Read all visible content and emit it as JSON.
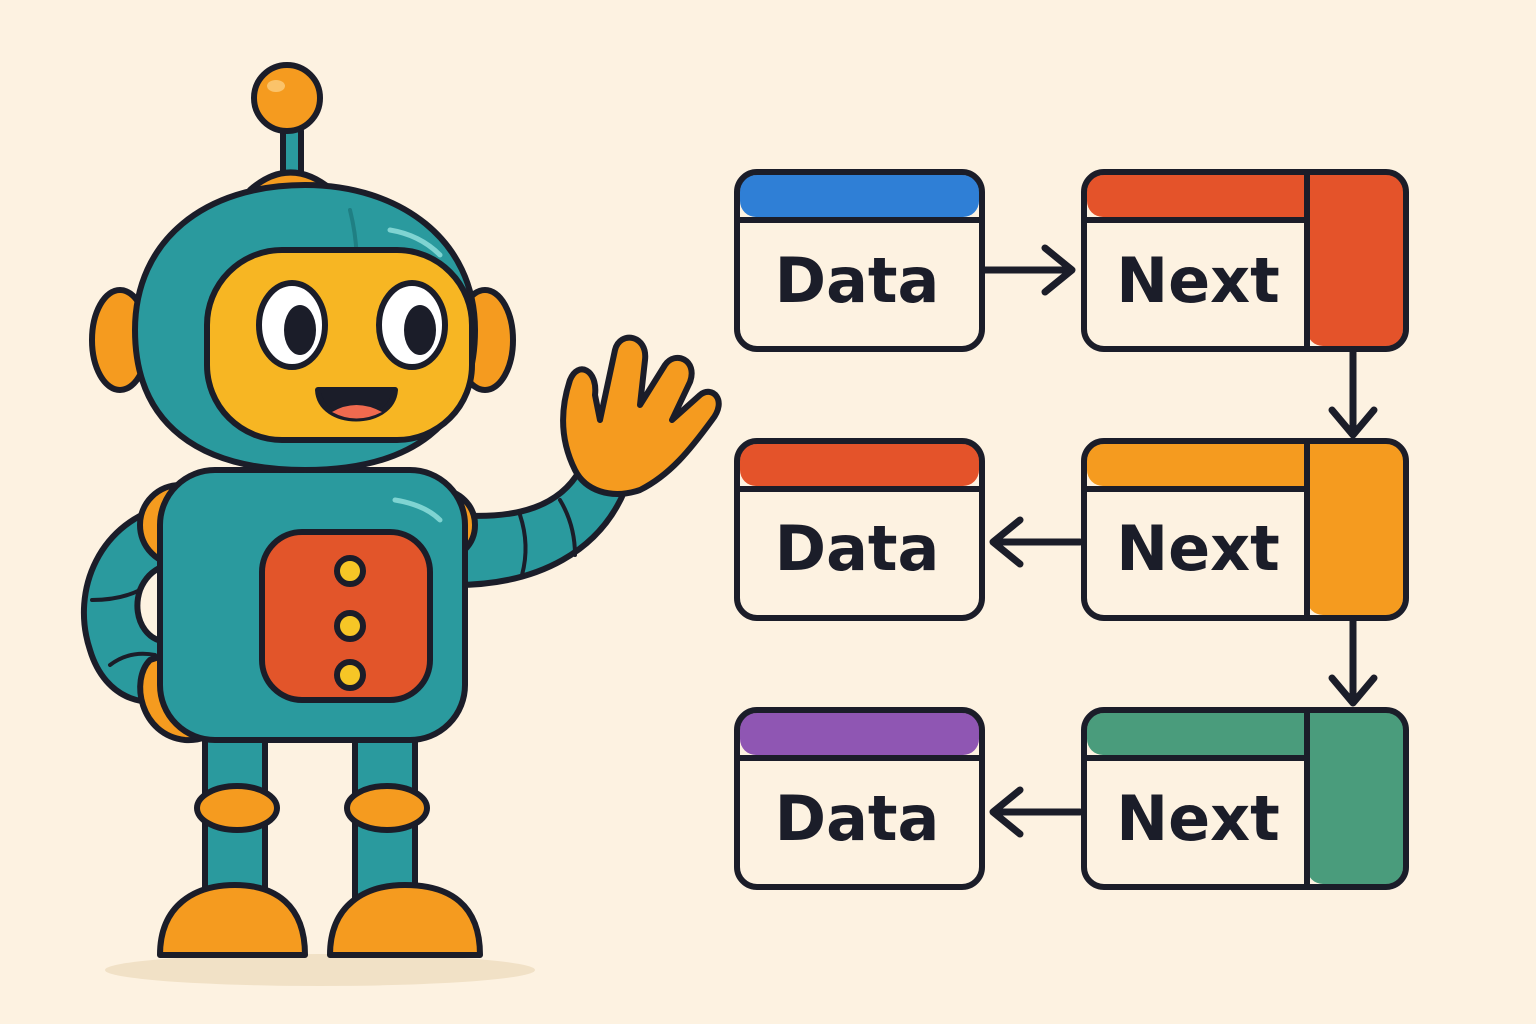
{
  "colors": {
    "background": "#fdf2e1",
    "outline": "#1b1d29",
    "box_fill": "#fdf2e1",
    "robot_teal": "#2a9a9e",
    "robot_teal_dark": "#1f7f83",
    "robot_orange": "#f59b1f",
    "robot_face": "#f7b623",
    "robot_chest": "#e2552a",
    "robot_buttons": "#f6c626"
  },
  "robot": {
    "antenna_icon": "antenna-ball-icon",
    "chest_buttons": 3
  },
  "diagram": {
    "rows": [
      {
        "data_box": {
          "label": "Data",
          "accent": "#2f7fd6"
        },
        "next_box": {
          "label": "Next",
          "accent": "#e4532a"
        },
        "arrow_direction": "right"
      },
      {
        "data_box": {
          "label": "Data",
          "accent": "#e4532a"
        },
        "next_box": {
          "label": "Next",
          "accent": "#f59b1f"
        },
        "arrow_direction": "left"
      },
      {
        "data_box": {
          "label": "Data",
          "accent": "#8f56b3"
        },
        "next_box": {
          "label": "Next",
          "accent": "#4a9c7c"
        },
        "arrow_direction": "left"
      }
    ],
    "vertical_arrows": 2
  }
}
